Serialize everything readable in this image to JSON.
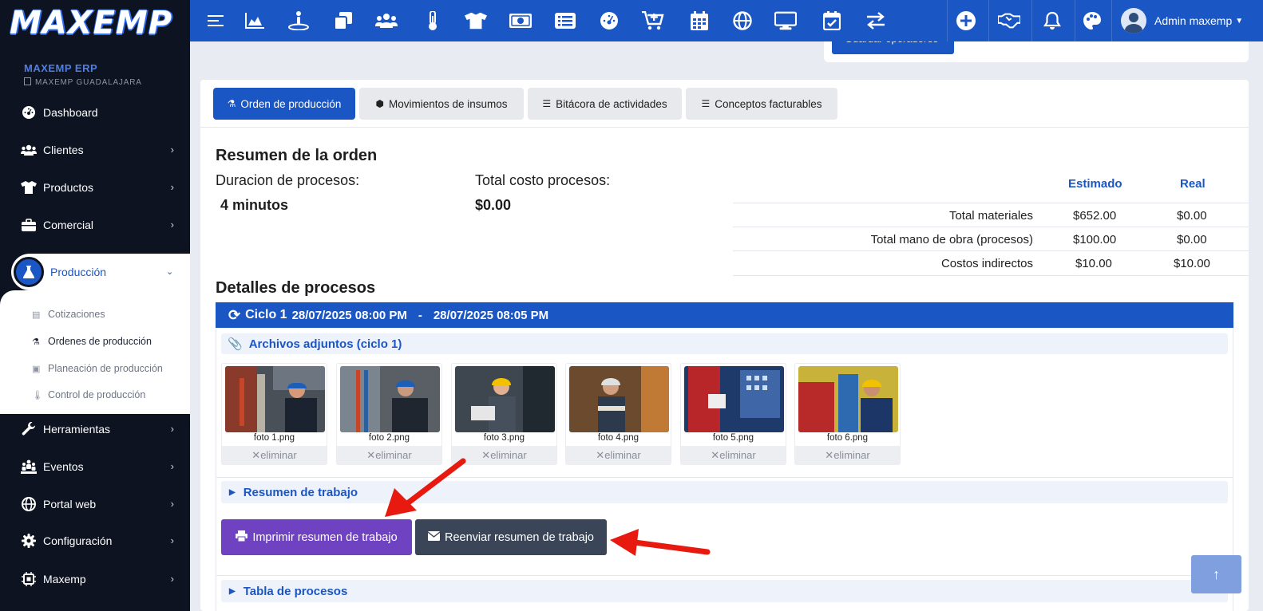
{
  "brand": {
    "logo": "MAXEMP",
    "erp_title": "MAXEMP ERP",
    "branch": "MAXEMP GUADALAJARA"
  },
  "sidebar": {
    "items": [
      {
        "label": "Dashboard",
        "icon": "dashboard-icon"
      },
      {
        "label": "Clientes",
        "icon": "users-icon"
      },
      {
        "label": "Productos",
        "icon": "tshirt-icon"
      },
      {
        "label": "Comercial",
        "icon": "briefcase-icon"
      },
      {
        "label": "Producción",
        "icon": "flask-icon"
      },
      {
        "label": "Herramientas",
        "icon": "wrench-icon"
      },
      {
        "label": "Eventos",
        "icon": "people-group-icon"
      },
      {
        "label": "Portal web",
        "icon": "globe-icon"
      },
      {
        "label": "Configuración",
        "icon": "gear-icon"
      },
      {
        "label": "Maxemp",
        "icon": "chip-icon"
      }
    ],
    "submenu": [
      {
        "label": "Cotizaciones",
        "icon": "table-icon"
      },
      {
        "label": "Ordenes de producción",
        "icon": "flask-icon"
      },
      {
        "label": "Planeación de producción",
        "icon": "calendar-check-icon"
      },
      {
        "label": "Control de producción",
        "icon": "thermometer-icon"
      }
    ]
  },
  "topbar": {
    "user": "Admin maxemp",
    "icons": [
      "menu-icon",
      "chart-area-icon",
      "person-station-icon",
      "clone-icon",
      "users-icon",
      "thermometer-icon",
      "tshirt-icon",
      "money-icon",
      "list-icon",
      "dashboard-icon",
      "cart-plus-icon",
      "calendar-icon",
      "globe-icon",
      "desktop-icon",
      "calendar-check-icon",
      "exchange-icon",
      "plus-circle-icon",
      "handshake-icon",
      "bell-icon",
      "palette-icon"
    ]
  },
  "top_card": {
    "button_label": "Guardar operadores"
  },
  "tabs": [
    {
      "label": "Orden de producción",
      "icon": "flask-icon"
    },
    {
      "label": "Movimientos de insumos",
      "icon": "cubes-icon"
    },
    {
      "label": "Bitácora de actividades",
      "icon": "list-indent-icon"
    },
    {
      "label": "Conceptos facturables",
      "icon": "list-indent-icon"
    }
  ],
  "resumen": {
    "title": "Resumen de la orden",
    "duracion_label": "Duracion de procesos:",
    "duracion_value": "4 minutos",
    "costo_label": "Total costo procesos:",
    "costo_value": "$0.00"
  },
  "cost_table": {
    "headers": [
      "Estimado",
      "Real"
    ],
    "rows": [
      {
        "label": "Total materiales",
        "estimado": "$652.00",
        "real": "$0.00"
      },
      {
        "label": "Total mano de obra (procesos)",
        "estimado": "$100.00",
        "real": "$0.00"
      },
      {
        "label": "Costos indirectos",
        "estimado": "$10.00",
        "real": "$10.00"
      }
    ]
  },
  "detalles": {
    "title": "Detalles de procesos",
    "cycle": {
      "name": "Ciclo 1",
      "start": "28/07/2025 08:00 PM",
      "separator": "-",
      "end": "28/07/2025 08:05 PM"
    },
    "attachments_title": "Archivos adjuntos (ciclo 1)",
    "attachments": [
      {
        "name": "foto 1.png",
        "delete": "eliminar"
      },
      {
        "name": "foto 2.png",
        "delete": "eliminar"
      },
      {
        "name": "foto 3.png",
        "delete": "eliminar"
      },
      {
        "name": "foto 4.png",
        "delete": "eliminar"
      },
      {
        "name": "foto 5.png",
        "delete": "eliminar"
      },
      {
        "name": "foto 6.png",
        "delete": "eliminar"
      }
    ],
    "resumen_trabajo": "Resumen de trabajo",
    "print_button": "Imprimir resumen de trabajo",
    "resend_button": "Reenviar resumen de trabajo",
    "tabla_procesos": "Tabla de procesos"
  },
  "colors": {
    "primary": "#1a56c4",
    "sidebar": "#0d1321",
    "print": "#6f42c1",
    "resend": "#3a4558",
    "arrow": "#e8190f"
  }
}
